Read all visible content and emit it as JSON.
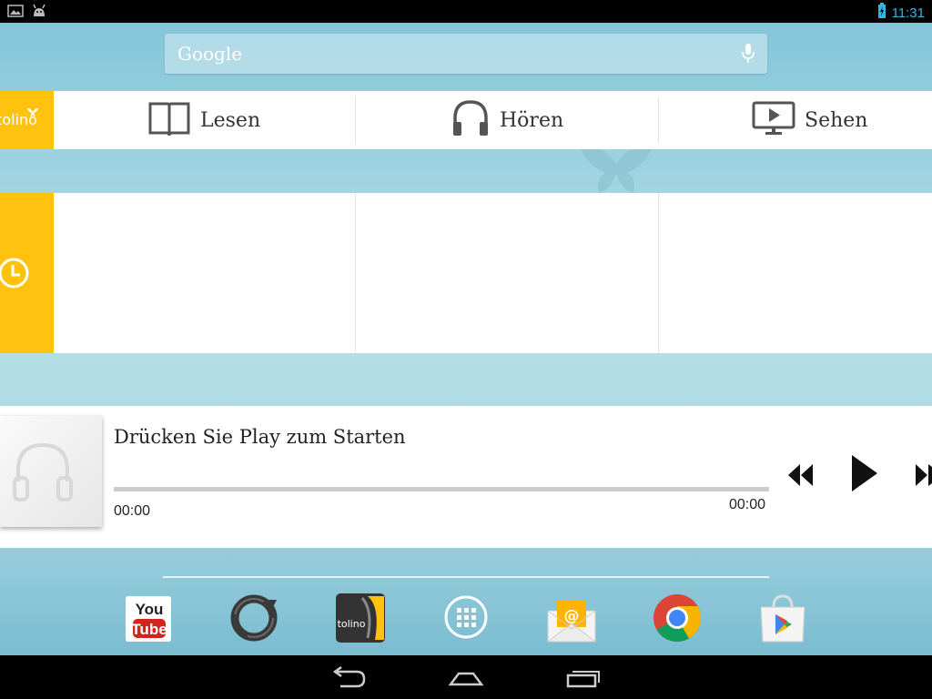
{
  "status_bar": {
    "time": "11:31",
    "icons": [
      "gallery-notification-icon",
      "android-notification-icon",
      "battery-charging-icon"
    ]
  },
  "search": {
    "label": "Google",
    "icon": "mic-icon"
  },
  "brand": {
    "logo_text": "tolino"
  },
  "media": {
    "items": [
      {
        "label": "Lesen",
        "icon": "book-icon"
      },
      {
        "label": "Hören",
        "icon": "headphones-icon"
      },
      {
        "label": "Sehen",
        "icon": "monitor-play-icon"
      }
    ]
  },
  "history": {
    "icon": "clock-icon"
  },
  "player": {
    "title": "Drücken Sie Play zum Starten",
    "position": "00:00",
    "duration": "00:00",
    "progress": 0
  },
  "dock": {
    "apps": [
      {
        "name": "youtube",
        "label_top": "You",
        "label_bottom": "Tube"
      },
      {
        "name": "sync"
      },
      {
        "name": "tolino",
        "label": "tolino"
      },
      {
        "name": "all-apps"
      },
      {
        "name": "email",
        "label": "@"
      },
      {
        "name": "chrome"
      },
      {
        "name": "play-store"
      }
    ]
  },
  "nav": {
    "items": [
      "back",
      "home",
      "recent-apps"
    ]
  },
  "colors": {
    "accent_yellow": "#ffc20e",
    "status_blue": "#33b5e5"
  }
}
